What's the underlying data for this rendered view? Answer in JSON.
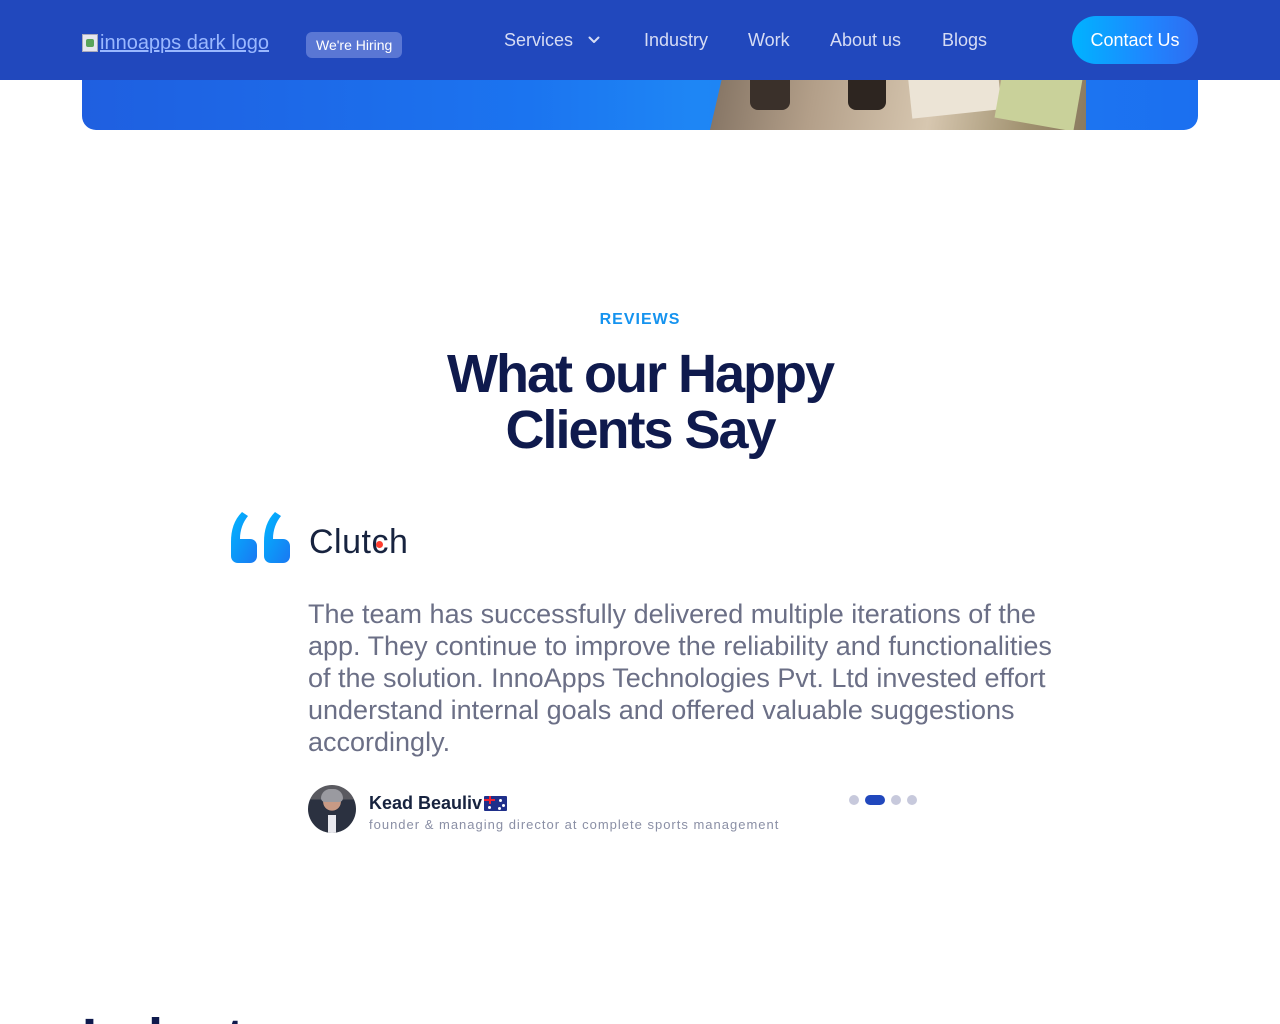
{
  "header": {
    "logo_alt": "innoapps dark logo",
    "hiring_badge": "We're Hiring",
    "nav": {
      "services": "Services",
      "industry": "Industry",
      "work": "Work",
      "about": "About us",
      "blogs": "Blogs"
    },
    "contact_label": "Contact Us"
  },
  "reviews": {
    "eyebrow": "REVIEWS",
    "title_line1": "What our Happy",
    "title_line2": "Clients Say",
    "source": "Clutch",
    "text_lines": [
      "The team has successfully delivered multiple iterations of the",
      "app. They continue to improve the reliability and functionalities",
      "of the solution. InnoApps Technologies Pvt. Ltd invested effort",
      "understand internal goals and offered valuable suggestions",
      "accordingly."
    ],
    "reviewer": {
      "name": "Kead Beauliv",
      "role": "founder & managing director at complete sports management",
      "flag": "australia-flag-icon"
    },
    "carousel": {
      "total": 4,
      "active_index": 1
    }
  },
  "next_section": {
    "heading_fragment": "Industr"
  },
  "colors": {
    "header_bg": "#2148bd",
    "accent": "#1593ef",
    "title": "#0f1a4d",
    "body_text": "#6b6f86"
  }
}
